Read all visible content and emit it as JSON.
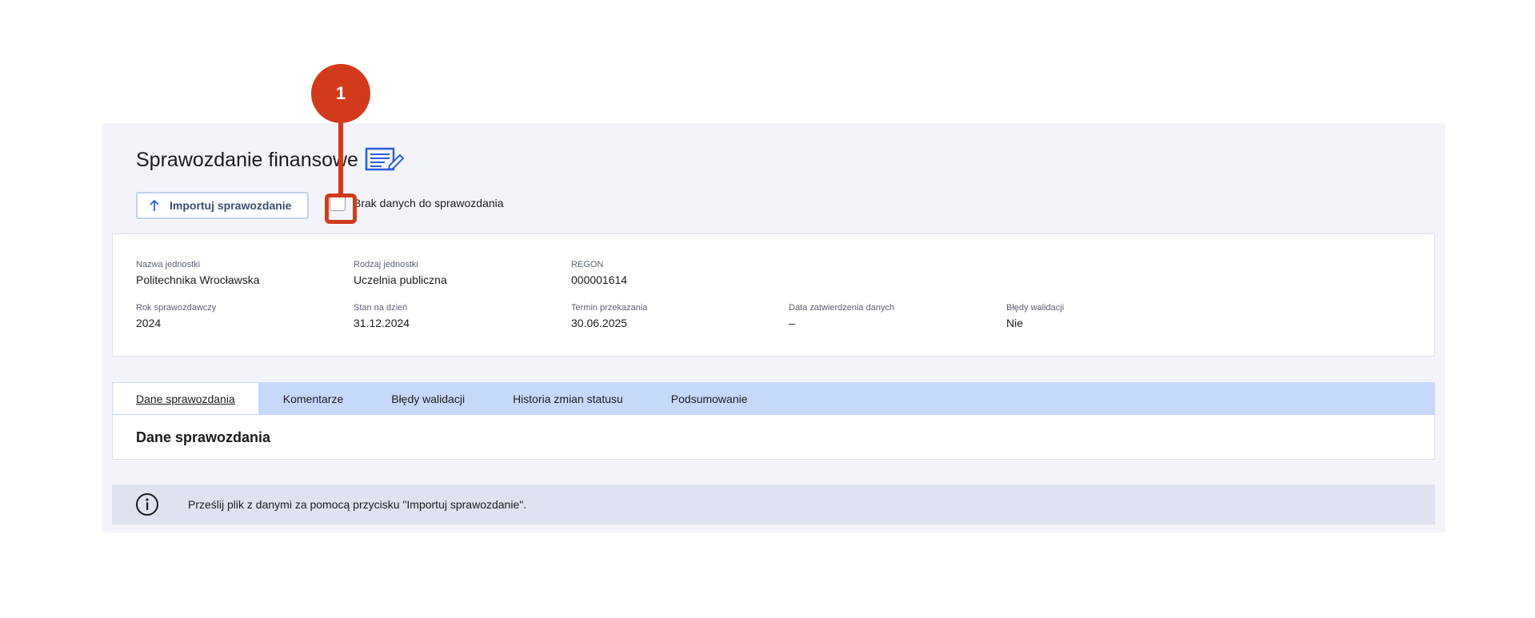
{
  "header": {
    "title": "Sprawozdanie finansowe",
    "title_icon": "report-edit-icon"
  },
  "toolbar": {
    "import_label": "Importuj sprawozdanie",
    "import_icon": "arrow-up-icon",
    "no_data_label": "Brak danych do sprawozdania",
    "no_data_checked": false
  },
  "info": {
    "nazwa_jednostki": {
      "label": "Nazwa jednostki",
      "value": "Politechnika Wrocławska"
    },
    "rodzaj_jednostki": {
      "label": "Rodzaj jednostki",
      "value": "Uczelnia publiczna"
    },
    "regon": {
      "label": "REGON",
      "value": "000001614"
    },
    "rok": {
      "label": "Rok sprawozdawczy",
      "value": "2024"
    },
    "stan": {
      "label": "Stan na dzień",
      "value": "31.12.2024"
    },
    "termin": {
      "label": "Termin przekazania",
      "value": "30.06.2025"
    },
    "data_zatw": {
      "label": "Data zatwierdzenia danych",
      "value": "–"
    },
    "bledy": {
      "label": "Błędy walidacji",
      "value": "Nie"
    }
  },
  "tabs": [
    {
      "label": "Dane sprawozdania",
      "active": true
    },
    {
      "label": "Komentarze",
      "active": false
    },
    {
      "label": "Błędy walidacji",
      "active": false
    },
    {
      "label": "Historia zmian statusu",
      "active": false
    },
    {
      "label": "Podsumowanie",
      "active": false
    }
  ],
  "content": {
    "section_title": "Dane sprawozdania"
  },
  "notice": {
    "icon": "info-icon",
    "text": "Prześlij plik z danymi za pomocą przycisku \"Importuj sprawozdanie\"."
  },
  "callout": {
    "number": "1",
    "color": "#d13b1c"
  },
  "colors": {
    "panel_bg": "#f3f4f9",
    "tabs_bg": "#c7d9fb",
    "notice_bg": "#dfe3ef",
    "accent_blue": "#2b5fd9"
  }
}
